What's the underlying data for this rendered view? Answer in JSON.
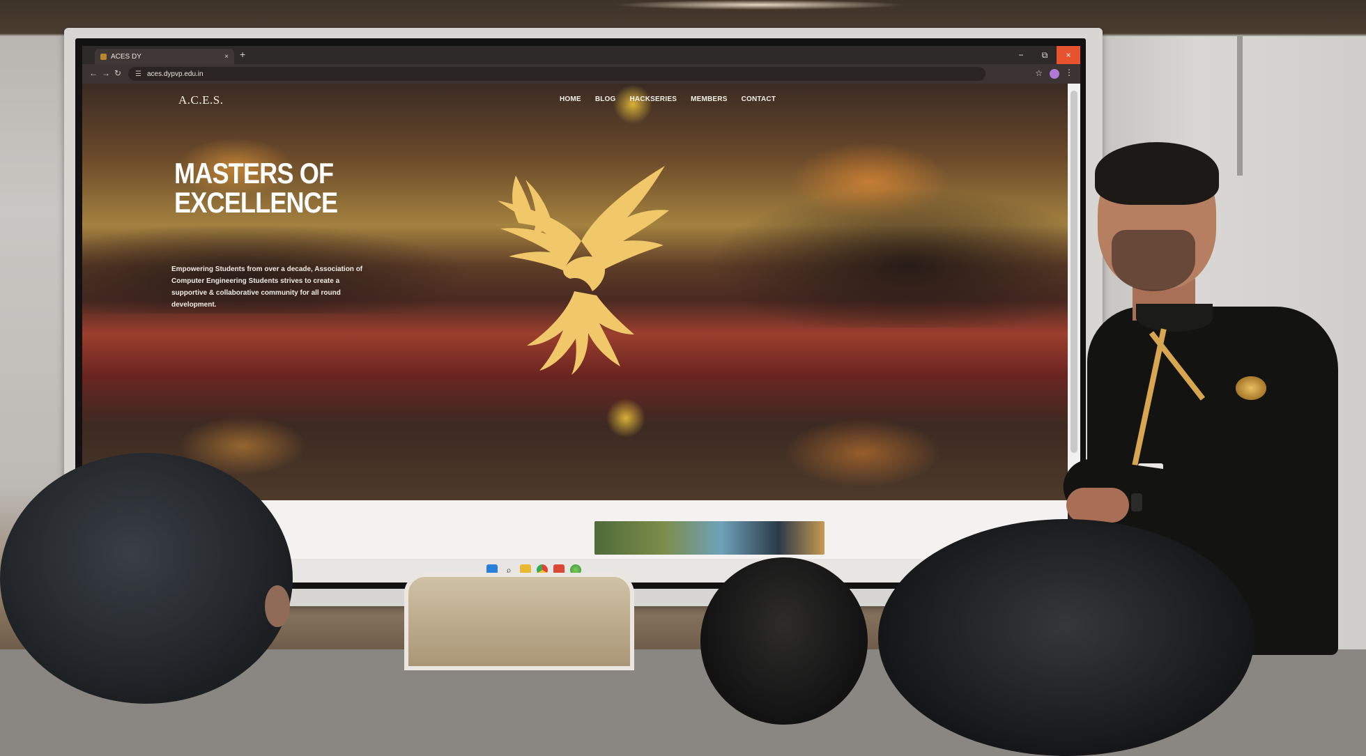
{
  "browser": {
    "tab_title": "ACES DY",
    "tab_close": "×",
    "new_tab": "+",
    "url": "aces.dypvp.edu.in",
    "window_controls": {
      "minimize": "−",
      "maximize": "⧉",
      "close": "×"
    }
  },
  "site": {
    "logo": "A.C.E.S.",
    "nav": [
      "HOME",
      "BLOG",
      "HACKSERIES",
      "MEMBERS",
      "CONTACT"
    ],
    "hero_title_line1": "MASTERS OF",
    "hero_title_line2": "EXCELLENCE",
    "hero_description": "Empowering Students from over a decade, Association of Computer Engineering Students strives to create a supportive & collaborative community for all round development."
  },
  "icons": [
    "back-arrow-icon",
    "forward-arrow-icon",
    "reload-icon",
    "site-info-icon",
    "bookmark-star-icon",
    "profile-avatar-icon",
    "menu-kebab-icon",
    "phoenix-logo-icon",
    "windows-start-icon",
    "search-icon",
    "file-explorer-icon",
    "chrome-icon"
  ],
  "colors": {
    "accent_gold": "#f0c86a",
    "window_close": "#e8532f",
    "hero_text": "#ffffff"
  }
}
